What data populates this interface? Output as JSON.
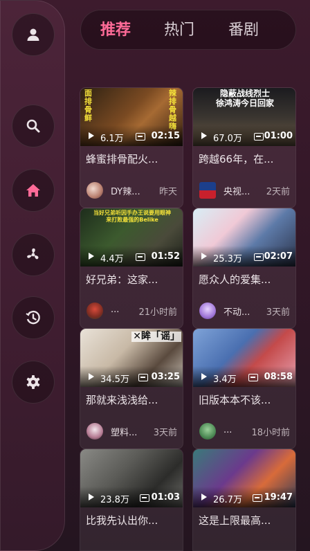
{
  "sidebar": {
    "items": [
      {
        "name": "profile",
        "icon": "user-icon"
      },
      {
        "name": "search",
        "icon": "search-icon"
      },
      {
        "name": "home",
        "icon": "home-icon",
        "active": true
      },
      {
        "name": "partition",
        "icon": "pinwheel-icon"
      },
      {
        "name": "history",
        "icon": "history-icon"
      },
      {
        "name": "settings",
        "icon": "gear-icon"
      }
    ]
  },
  "tabs": [
    {
      "label": "推荐",
      "active": true
    },
    {
      "label": "热门",
      "active": false
    },
    {
      "label": "番剧",
      "active": false
    }
  ],
  "colors": {
    "accent": "#ff6b98",
    "background": "#321727",
    "sidebar": "#4c2439"
  },
  "videos": [
    {
      "title": "蜂蜜排骨配火...",
      "views": "6.1万",
      "duration": "02:15",
      "author": "DY辣...",
      "time": "昨天",
      "thumb_text": [
        "面排骨鲜",
        "辣排骨越嗨"
      ]
    },
    {
      "title": "跨越66年，在...",
      "views": "67.0万",
      "duration": "01:00",
      "author": "央视...",
      "time": "2天前",
      "thumb_text": [
        "隐蔽战线烈士",
        "徐鸿涛今日回家"
      ]
    },
    {
      "title": "好兄弟：这家...",
      "views": "4.4万",
      "duration": "01:52",
      "author": "...",
      "time": "21小时前",
      "thumb_text": [
        "当好兄弟听因手办王说要用眼神",
        "来打败最强的Belike"
      ]
    },
    {
      "title": "愿众人的爱集...",
      "views": "25.3万",
      "duration": "02:07",
      "author": "不动...",
      "time": "3天前",
      "thumb_text": []
    },
    {
      "title": "那就来浅浅给...",
      "views": "34.5万",
      "duration": "03:25",
      "author": "塑料...",
      "time": "3天前",
      "thumb_text": [
        "✕眸「谣」"
      ]
    },
    {
      "title": "旧版本本不该...",
      "views": "3.4万",
      "duration": "08:58",
      "author": "...",
      "time": "18小时前",
      "thumb_text": []
    },
    {
      "title": "比我先认出你...",
      "views": "23.8万",
      "duration": "01:03",
      "author": "",
      "time": "",
      "thumb_text": []
    },
    {
      "title": "这是上限最高...",
      "views": "26.7万",
      "duration": "19:47",
      "author": "",
      "time": "",
      "thumb_text": []
    }
  ]
}
